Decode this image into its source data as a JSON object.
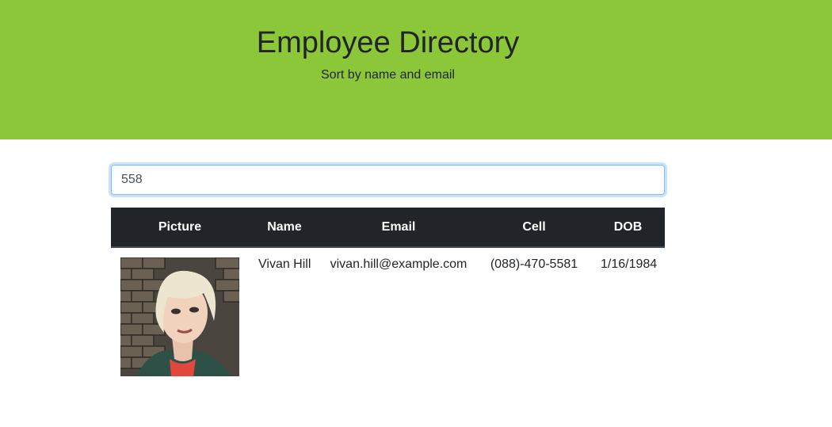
{
  "header": {
    "title": "Employee Directory",
    "subtitle": "Sort by name and email",
    "background": "#8bc738"
  },
  "search": {
    "value": "558"
  },
  "table": {
    "columns": [
      "Picture",
      "Name",
      "Email",
      "Cell",
      "DOB"
    ],
    "rows": [
      {
        "picture": "employee-photo",
        "name": "Vivan Hill",
        "email": "vivan.hill@example.com",
        "cell": "(088)-470-5581",
        "dob": "1/16/1984"
      }
    ]
  }
}
